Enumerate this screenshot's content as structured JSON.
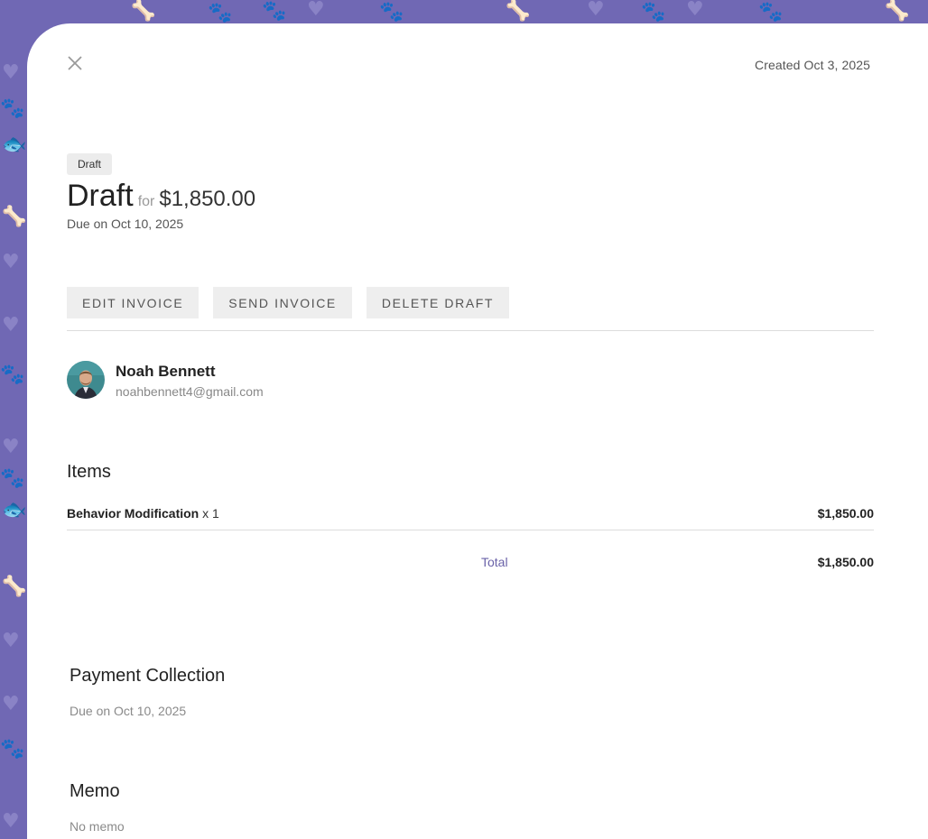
{
  "header": {
    "created": "Created Oct 3, 2025"
  },
  "invoice": {
    "badge": "Draft",
    "status": "Draft",
    "for_word": "for",
    "amount": "$1,850.00",
    "due": "Due on Oct 10, 2025"
  },
  "actions": {
    "edit": "EDIT INVOICE",
    "send": "SEND INVOICE",
    "delete": "DELETE DRAFT"
  },
  "customer": {
    "name": "Noah Bennett",
    "email": "noahbennett4@gmail.com"
  },
  "items": {
    "heading": "Items",
    "rows": [
      {
        "name": "Behavior Modification",
        "qty": "x 1",
        "amount": "$1,850.00"
      }
    ],
    "total_label": "Total",
    "total_amount": "$1,850.00"
  },
  "payment": {
    "heading": "Payment Collection",
    "due": "Due on Oct 10, 2025"
  },
  "memo": {
    "heading": "Memo",
    "text": "No memo"
  },
  "colors": {
    "background": "#7068b4",
    "accent": "#6a62a8"
  },
  "icons": {
    "close": "close-icon",
    "background_pattern": [
      "bone-icon",
      "paw-icon",
      "heart-icon",
      "fish-icon"
    ]
  }
}
